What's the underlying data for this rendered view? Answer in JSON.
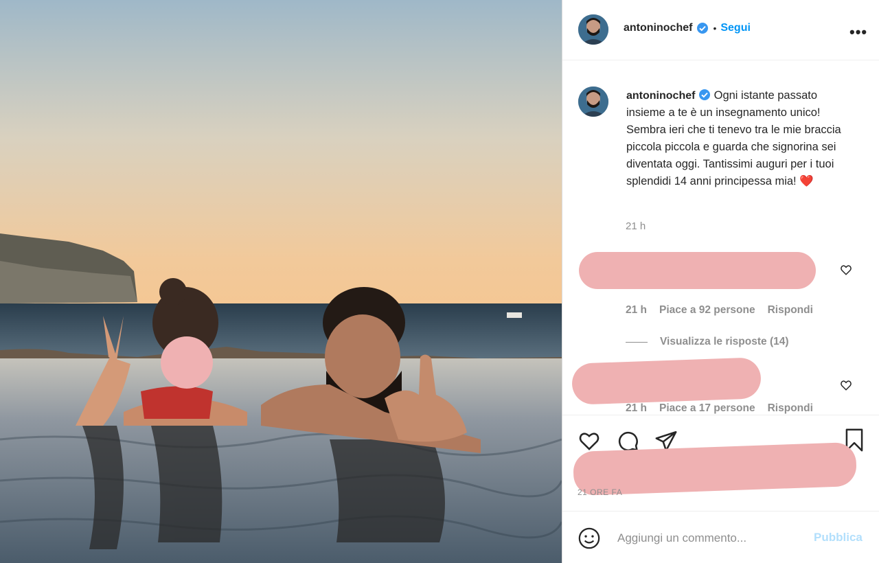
{
  "post": {
    "username": "antoninochef",
    "dot": "•",
    "follow_label": "Segui",
    "more_label": "•••",
    "caption": "Ogni istante passato insieme a te è un insegnamento unico! Sembra ieri che ti tenevo tra le mie braccia piccola piccola e guarda che signorina sei diventata oggi. Tantissimi auguri per i tuoi splendidi 14 anni principessa mia!",
    "caption_emoji": "❤️",
    "caption_time": "21 h"
  },
  "comments": [
    {
      "time": "21 h",
      "likes": "Piace a 92 persone",
      "reply": "Rispondi",
      "view_replies": "Visualizza le risposte (14)"
    },
    {
      "time": "21 h",
      "likes": "Piace a 17 persone",
      "reply": "Rispondi"
    }
  ],
  "actions": {
    "time_ago": "21 ORE FA"
  },
  "comment_input": {
    "placeholder": "Aggiungi un commento...",
    "publish_label": "Pubblica"
  },
  "icons": {
    "verified": "verified-badge-icon",
    "like": "heart-icon",
    "comment": "comment-icon",
    "share": "share-icon",
    "save": "bookmark-icon",
    "emoji": "emoji-icon",
    "more": "more-icon"
  },
  "colors": {
    "accent": "#0095f6",
    "verified": "#3897f0",
    "text": "#262626",
    "muted": "#8e8e8e",
    "heart": "#ed4956"
  }
}
